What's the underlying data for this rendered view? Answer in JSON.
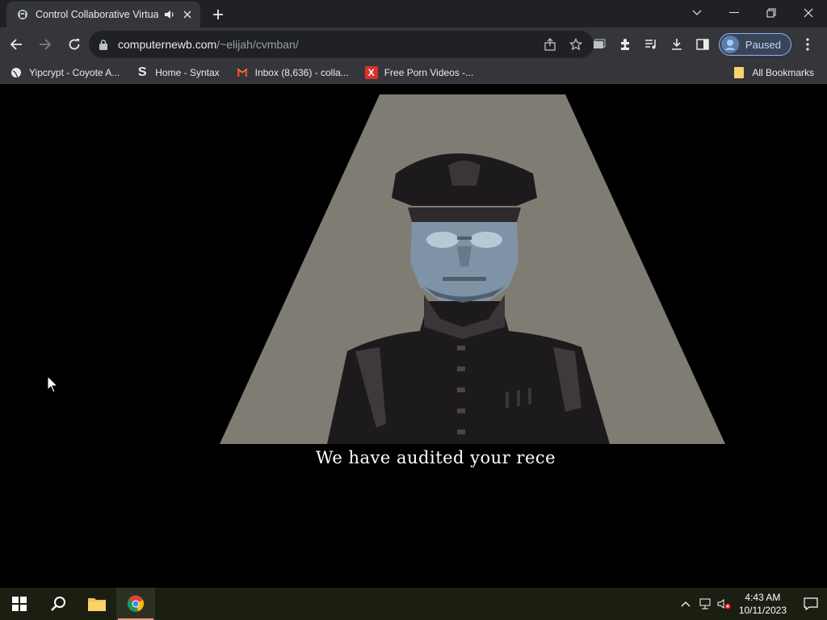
{
  "tab": {
    "title": "Control Collaborative Virtua",
    "favicon": "bull-icon",
    "audio_icon": "speaker-icon"
  },
  "window_controls": [
    "chevron-down-icon",
    "minimize-icon",
    "restore-icon",
    "close-icon"
  ],
  "toolbar": {
    "url_host": "computernewb.com",
    "url_path": "/~elijah/cvmban/",
    "profile_label": "Paused"
  },
  "bookmarks": [
    {
      "label": "Yipcrypt - Coyote A...",
      "icon": "globe-icon"
    },
    {
      "label": "Home - Syntax",
      "icon": "syntax-icon",
      "glyph": "S"
    },
    {
      "label": "Inbox (8,636) - colla...",
      "icon": "gmail-icon",
      "glyph": "M"
    },
    {
      "label": "Free Porn Videos -...",
      "icon": "x-logo-icon",
      "glyph": "X"
    }
  ],
  "all_bookmarks_label": "All Bookmarks",
  "page": {
    "caption": "We have audited your rece"
  },
  "taskbar": {
    "time": "4:43 AM",
    "date": "10/11/2023"
  },
  "colors": {
    "spotlight": "#7f7c73",
    "face": "#7e93a6",
    "uniform": "#1c1a1c",
    "uniform_light": "#3a3538",
    "profile_accent": "#8ab4f8"
  }
}
